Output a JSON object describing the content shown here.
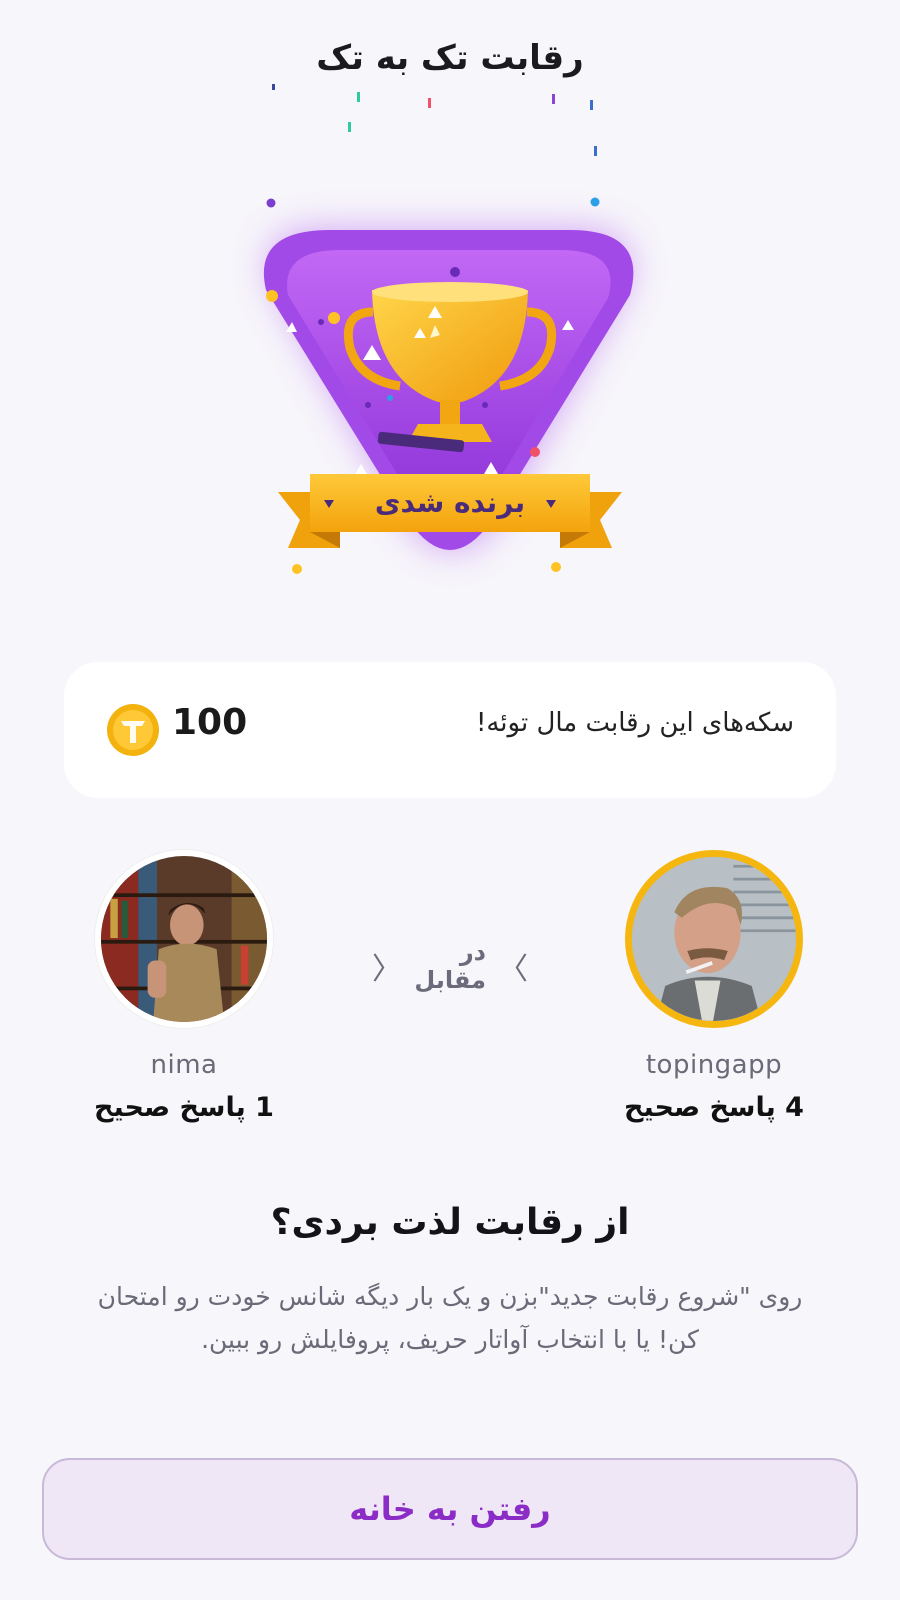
{
  "header": {
    "title": "رقابت تک به تک"
  },
  "badge": {
    "ribbon_text": "برنده شدی"
  },
  "coins": {
    "message": "سکه‌های این رقابت مال توئه!",
    "amount": "100",
    "icon": "coin-icon",
    "coin_color": "#f4b20f"
  },
  "match": {
    "versus_label": "در مقابل",
    "players": [
      {
        "name": "topingapp",
        "score_text": "4 پاسخ صحیح",
        "winner": true
      },
      {
        "name": "nima",
        "score_text": "1 پاسخ صحیح",
        "winner": false
      }
    ]
  },
  "prompt": {
    "question": "از رقابت لذت بردی؟",
    "description": "روی \"شروع رقابت جدید\"بزن و یک بار دیگه شانس خودت رو امتحان کن! یا با انتخاب آواتار حریف، پروفایلش رو ببین."
  },
  "actions": {
    "home_label": "رفتن به خانه"
  },
  "colors": {
    "accent": "#8a2cc5",
    "badge_purple": "#a64ee8",
    "ribbon_gold": "#f5b30d",
    "winner_ring": "#f5b60f"
  }
}
